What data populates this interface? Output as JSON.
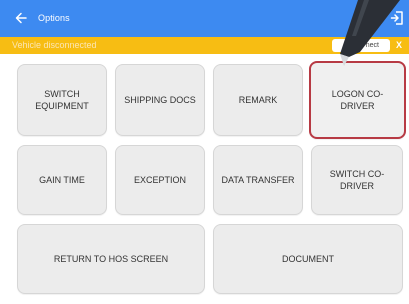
{
  "header": {
    "title": "Options",
    "back_icon": "arrow-left-icon",
    "refresh_icon": "refresh-icon",
    "exit_icon": "exit-icon",
    "background_color": "#3d8af1"
  },
  "status": {
    "text": "Vehicle disconnected",
    "connect_label": "nect",
    "close_label": "X",
    "background_color": "#f7bd13"
  },
  "menu": {
    "switch_equipment": "SWITCH EQUIPMENT",
    "shipping_docs": "SHIPPING DOCS",
    "remark": "REMARK",
    "logon_co_driver": "LOGON CO-DRIVER",
    "gain_time": "GAIN TIME",
    "exception": "EXCEPTION",
    "data_transfer": "DATA TRANSFER",
    "switch_co_driver": "SWITCH CO-DRIVER",
    "return_to_hos": "RETURN TO HOS SCREEN",
    "document": "DOCUMENT",
    "selected_item": "LOGON CO-DRIVER",
    "highlight_color": "#b73a44"
  }
}
